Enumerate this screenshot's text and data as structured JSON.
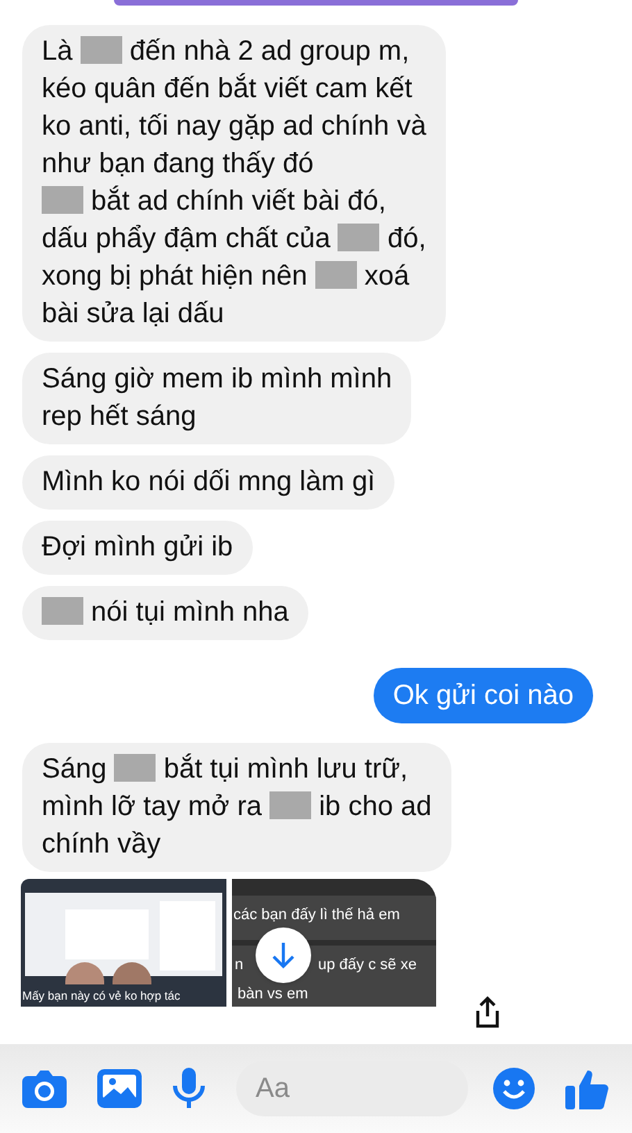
{
  "messages": [
    {
      "outgoing": false,
      "parts": [
        {
          "kind": "text",
          "text": "Là"
        },
        {
          "kind": "redacted"
        },
        {
          "kind": "text",
          "text": "đến nhà 2 ad group m,\nkéo quân đến bắt viết cam kết\nko anti, tối nay gặp ad chính và\nnhư bạn đang thấy đó\n"
        },
        {
          "kind": "redacted"
        },
        {
          "kind": "text",
          "text": "bắt ad chính viết bài đó,\ndấu phẩy đậm chất của"
        },
        {
          "kind": "redacted"
        },
        {
          "kind": "text",
          "text": "đó,\nxong bị phát hiện nên"
        },
        {
          "kind": "redacted"
        },
        {
          "kind": "text",
          "text": "xoá\nbài sửa lại dấu"
        }
      ]
    },
    {
      "outgoing": false,
      "parts": [
        {
          "kind": "text",
          "text": "Sáng giờ mem ib mình mình\nrep hết sáng"
        }
      ]
    },
    {
      "outgoing": false,
      "parts": [
        {
          "kind": "text",
          "text": "Mình ko nói dối mng làm gì"
        }
      ]
    },
    {
      "outgoing": false,
      "parts": [
        {
          "kind": "text",
          "text": "Đợi mình gửi ib"
        }
      ]
    },
    {
      "outgoing": false,
      "parts": [
        {
          "kind": "redacted"
        },
        {
          "kind": "text",
          "text": "nói tụi mình nha"
        }
      ]
    },
    {
      "outgoing": true,
      "parts": [
        {
          "kind": "text",
          "text": "Ok gửi coi nào"
        }
      ]
    },
    {
      "outgoing": false,
      "parts": [
        {
          "kind": "text",
          "text": "Sáng"
        },
        {
          "kind": "redacted"
        },
        {
          "kind": "text",
          "text": "bắt tụi mình lưu trữ,\nmình lỡ tay mở ra"
        },
        {
          "kind": "redacted"
        },
        {
          "kind": "text",
          "text": "ib cho ad\nchính vầy"
        }
      ]
    }
  ],
  "attachments": [
    {
      "kind": "desktop",
      "caption": "Mấy bạn này có vẻ ko hợp tác"
    },
    {
      "kind": "chat",
      "lines": [
        "các bạn đấy lì thế hả em",
        "n",
        "up đấy c sẽ xe",
        "bàn vs em"
      ]
    }
  ],
  "composer": {
    "placeholder": "Aa"
  }
}
